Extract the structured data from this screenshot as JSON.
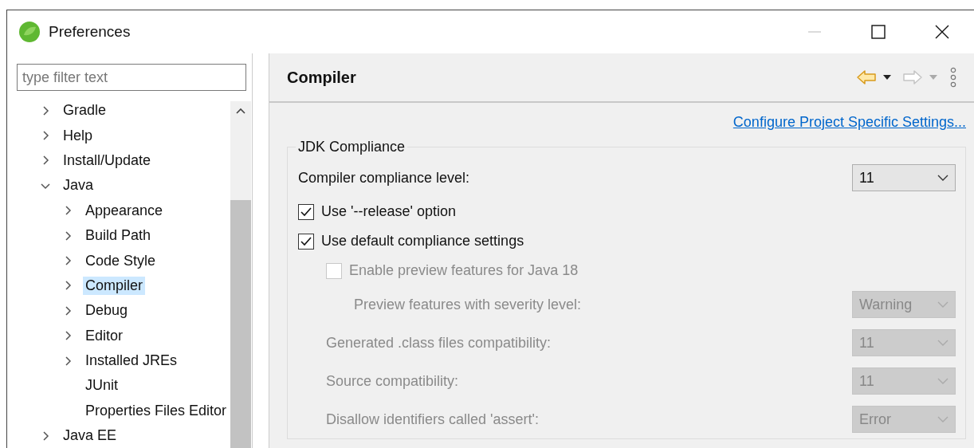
{
  "window": {
    "title": "Preferences"
  },
  "filter": {
    "placeholder": "type filter text"
  },
  "tree": [
    {
      "label": "Gradle",
      "kind": "folder",
      "expanded": false,
      "selected": false
    },
    {
      "label": "Help",
      "kind": "folder",
      "expanded": false,
      "selected": false
    },
    {
      "label": "Install/Update",
      "kind": "folder",
      "expanded": false,
      "selected": false
    },
    {
      "label": "Java",
      "kind": "folder",
      "expanded": true,
      "selected": false,
      "children": [
        {
          "label": "Appearance",
          "kind": "folder",
          "expanded": false,
          "selected": false
        },
        {
          "label": "Build Path",
          "kind": "folder",
          "expanded": false,
          "selected": false
        },
        {
          "label": "Code Style",
          "kind": "folder",
          "expanded": false,
          "selected": false
        },
        {
          "label": "Compiler",
          "kind": "folder",
          "expanded": false,
          "selected": true
        },
        {
          "label": "Debug",
          "kind": "folder",
          "expanded": false,
          "selected": false
        },
        {
          "label": "Editor",
          "kind": "folder",
          "expanded": false,
          "selected": false
        },
        {
          "label": "Installed JREs",
          "kind": "folder",
          "expanded": false,
          "selected": false
        },
        {
          "label": "JUnit",
          "kind": "leaf",
          "selected": false
        },
        {
          "label": "Properties Files Editor",
          "kind": "leaf",
          "selected": false
        }
      ]
    },
    {
      "label": "Java EE",
      "kind": "folder",
      "expanded": false,
      "selected": false
    }
  ],
  "page": {
    "title": "Compiler",
    "back": {
      "disabled": false
    },
    "forward": {
      "disabled": true
    },
    "link": "Configure Project Specific Settings...",
    "group": "JDK Compliance",
    "rows": [
      {
        "kind": "combo",
        "label": "Compiler compliance level:",
        "value": "11",
        "disabled": false
      },
      {
        "kind": "check",
        "label": "Use '--release' option",
        "checked": true,
        "disabled": false
      },
      {
        "kind": "check",
        "label": "Use default compliance settings",
        "checked": true,
        "disabled": false,
        "children": [
          {
            "kind": "check",
            "label": "Enable preview features for Java 18",
            "checked": false,
            "disabled": true,
            "children": [
              {
                "kind": "combo",
                "label": "Preview features with severity level:",
                "value": "Warning",
                "disabled": true
              }
            ]
          },
          {
            "kind": "combo",
            "label": "Generated .class files compatibility:",
            "value": "11",
            "disabled": true
          },
          {
            "kind": "combo",
            "label": "Source compatibility:",
            "value": "11",
            "disabled": true
          },
          {
            "kind": "combo",
            "label": "Disallow identifiers called 'assert':",
            "value": "Error",
            "disabled": true
          }
        ]
      }
    ]
  }
}
